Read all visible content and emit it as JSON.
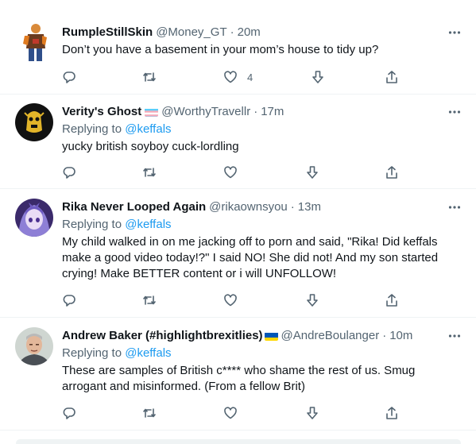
{
  "tweets": [
    {
      "name": "RumpleStillSkin",
      "handle": "@Money_GT",
      "time": "20m",
      "replying_prefix": "",
      "replying_to": "",
      "text": "Don’t you have a basement in your mom’s house to tidy up?",
      "like_count": "4",
      "avatar": "figure-avatar"
    },
    {
      "name": "Verity's Ghost",
      "handle": "@WorthyTravellr",
      "time": "17m",
      "replying_prefix": "Replying to ",
      "replying_to": "@keffals",
      "text": "yucky british soyboy cuck-lordling",
      "like_count": "",
      "avatar": "ghost-avatar"
    },
    {
      "name": "Rika Never Looped Again",
      "handle": "@rikaownsyou",
      "time": "13m",
      "replying_prefix": "Replying to ",
      "replying_to": "@keffals",
      "text": "My child walked in on me jacking off to porn and said, \"Rika! Did keffals make a good video today!?\" I said NO! She did not! And my son started crying! Make BETTER content or i will UNFOLLOW!",
      "like_count": "",
      "avatar": "anime-avatar"
    },
    {
      "name": "Andrew Baker (#highlightbrexitlies)",
      "handle": "@AndreBoulanger",
      "time": "10m",
      "replying_prefix": "Replying to ",
      "replying_to": "@keffals",
      "text": "These are samples of British c**** who shame the rest of us. Smug arrogant and misinformed. (From a fellow Brit)",
      "like_count": "",
      "avatar": "man-avatar"
    }
  ],
  "separator": "·",
  "colors": {
    "text": "#0f1419",
    "muted": "#536471",
    "link": "#1d9bf0",
    "border": "#eff3f4"
  },
  "icons": [
    "more-icon",
    "reply-icon",
    "retweet-icon",
    "like-icon",
    "downvote-icon",
    "share-icon",
    "trans-flag-icon",
    "ukraine-flag-icon"
  ]
}
